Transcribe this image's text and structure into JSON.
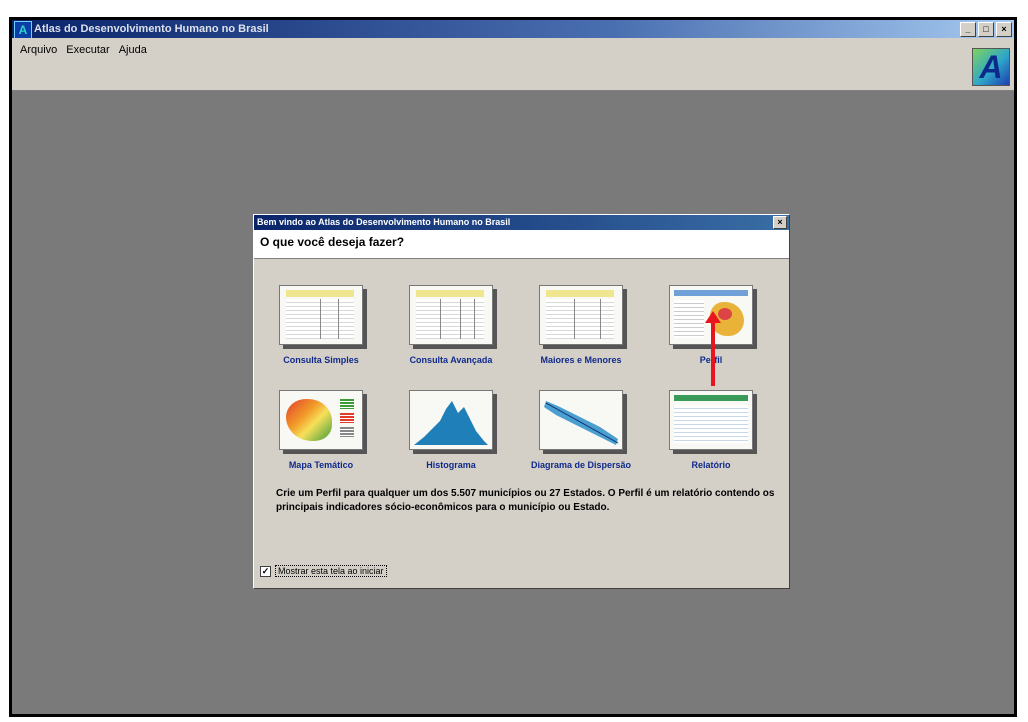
{
  "app": {
    "title": "Atlas do Desenvolvimento Humano no Brasil",
    "icon_letter": "A",
    "window_buttons": [
      "_",
      "□",
      "×"
    ]
  },
  "menu": [
    "Arquivo",
    "Executar",
    "Ajuda"
  ],
  "logo_letter": "A",
  "dialog": {
    "title": "Bem vindo ao Atlas do Desenvolvimento Humano no Brasil",
    "close": "×",
    "question": "O que você deseja fazer?",
    "options": [
      {
        "label": "Consulta Simples",
        "icon": "table-icon"
      },
      {
        "label": "Consulta Avançada",
        "icon": "table-icon"
      },
      {
        "label": "Maiores e Menores",
        "icon": "table-icon"
      },
      {
        "label": "Perfil",
        "icon": "profile-map-icon"
      },
      {
        "label": "Mapa Temático",
        "icon": "brazil-map-icon"
      },
      {
        "label": "Histograma",
        "icon": "histogram-icon"
      },
      {
        "label": "Diagrama de Dispersão",
        "icon": "scatter-icon"
      },
      {
        "label": "Relatório",
        "icon": "report-icon"
      }
    ],
    "description": "Crie um Perfil para qualquer um dos 5.507 municípios ou 27 Estados. O Perfil é um relatório contendo os principais indicadores sócio-econômicos para o município ou Estado.",
    "checkbox": {
      "label": "Mostrar esta tela ao iniciar",
      "checked": true,
      "mark": "✓"
    }
  },
  "colors": {
    "title_bar": "#0a246a",
    "workspace": "#7a7a7a",
    "option_label": "#102a8c",
    "arrow": "#e8141e"
  }
}
